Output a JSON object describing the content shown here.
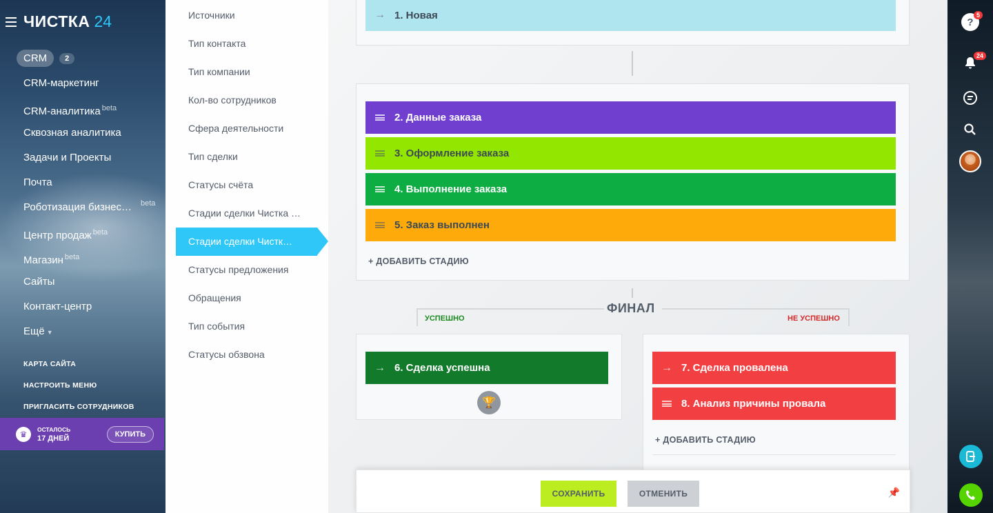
{
  "leftnav": {
    "logo": "ЧИСТКА",
    "logo_num": "24",
    "crm": "CRM",
    "crm_count": "2",
    "items": [
      {
        "label": "CRM-маркетинг",
        "beta": ""
      },
      {
        "label": "CRM-аналитика",
        "beta": "beta"
      },
      {
        "label": "Сквозная аналитика",
        "beta": ""
      },
      {
        "label": "Задачи и Проекты",
        "beta": ""
      },
      {
        "label": "Почта",
        "beta": ""
      },
      {
        "label": "Роботизация бизнес…",
        "beta": "beta"
      },
      {
        "label": "Центр продаж",
        "beta": "beta"
      },
      {
        "label": "Магазин",
        "beta": "beta"
      },
      {
        "label": "Сайты",
        "beta": ""
      },
      {
        "label": "Контакт-центр",
        "beta": ""
      },
      {
        "label": "Ещё",
        "beta": ""
      }
    ],
    "links": [
      "КАРТА САЙТА",
      "НАСТРОИТЬ МЕНЮ",
      "ПРИГЛАСИТЬ СОТРУДНИКОВ"
    ],
    "trial": {
      "line1": "ОСТАЛОСЬ",
      "line2": "17 ДНЕЙ",
      "buy": "КУПИТЬ"
    }
  },
  "settings_list": [
    "Источники",
    "Тип контакта",
    "Тип компании",
    "Кол-во сотрудников",
    "Сфера деятельности",
    "Тип сделки",
    "Статусы счёта",
    "Стадии сделки Чистка …",
    "Стадии сделки Чистк…",
    "Статусы предложения",
    "Обращения",
    "Тип события",
    "Статусы обзвона"
  ],
  "stages": {
    "start": {
      "label": "1. Новая",
      "color": "#aee5ef"
    },
    "process": [
      {
        "label": "2. Данные заказа",
        "color": "#713fcf"
      },
      {
        "label": "3. Оформление заказа",
        "color": "#92e600"
      },
      {
        "label": "4. Выполнение заказа",
        "color": "#0dad43"
      },
      {
        "label": "5. Заказ выполнен",
        "color": "#fdaa0a"
      }
    ],
    "add_stage": "+ ДОБАВИТЬ СТАДИЮ",
    "final_title": "ФИНАЛ",
    "success_label": "УСПЕШНО",
    "fail_label": "НЕ УСПЕШНО",
    "success": {
      "label": "6. Сделка успешна",
      "color": "#117a2b"
    },
    "fail": [
      {
        "label": "7. Сделка провалена",
        "color": "#f24042"
      },
      {
        "label": "8. Анализ причины провала",
        "color": "#f24042"
      }
    ],
    "add_stage_fail": "+ ДОБАВИТЬ СТАДИЮ"
  },
  "footer": {
    "save": "СОХРАНИТЬ",
    "cancel": "ОТМЕНИТЬ"
  },
  "rightrail": {
    "help_badge": "5",
    "notify_badge": "24"
  }
}
